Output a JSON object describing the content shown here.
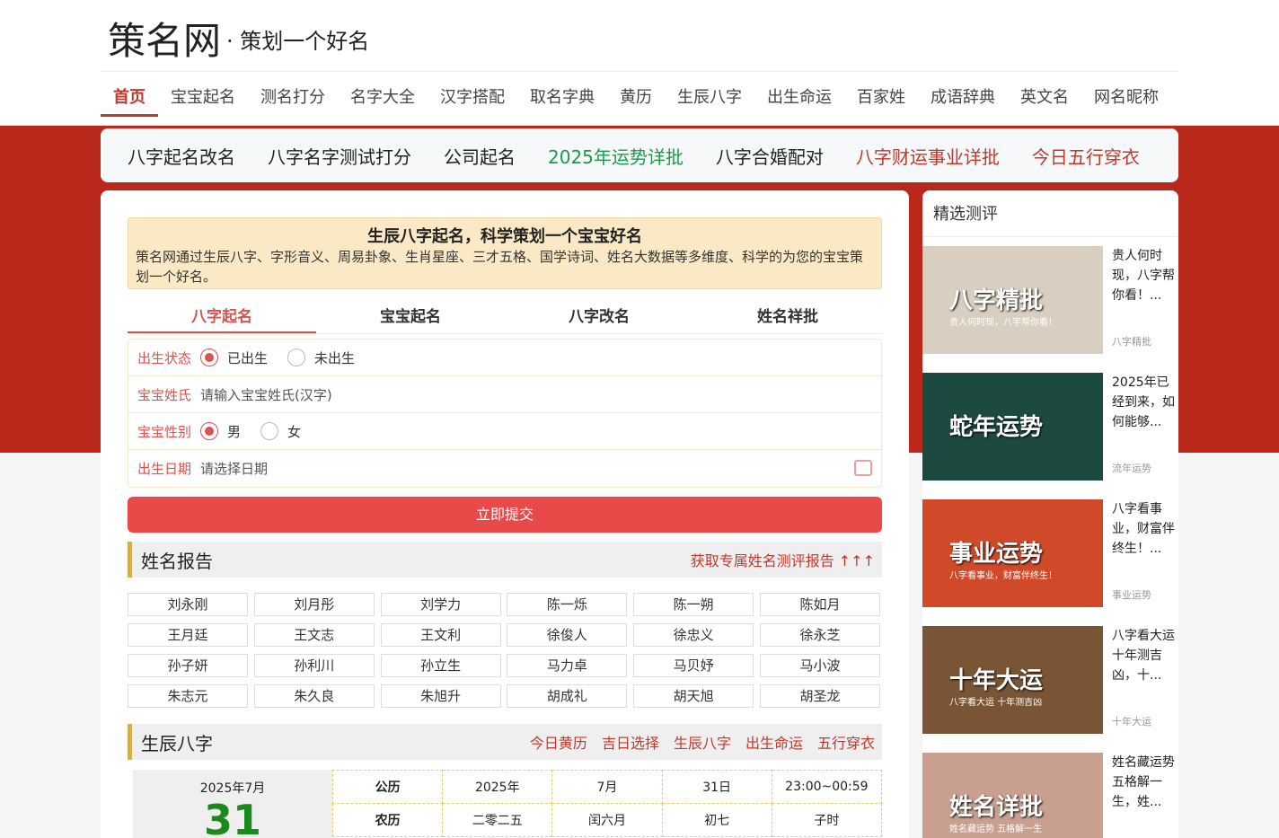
{
  "header": {
    "logo": "策名网",
    "slogan": "· 策划一个好名"
  },
  "nav": [
    "首页",
    "宝宝起名",
    "测名打分",
    "名字大全",
    "汉字搭配",
    "取名字典",
    "黄历",
    "生辰八字",
    "出生命运",
    "百家姓",
    "成语辞典",
    "英文名",
    "网名昵称"
  ],
  "subnav": [
    {
      "label": "八字起名改名",
      "style": "normal"
    },
    {
      "label": "八字名字测试打分",
      "style": "normal"
    },
    {
      "label": "公司起名",
      "style": "normal"
    },
    {
      "label": "2025年运势详批",
      "style": "green"
    },
    {
      "label": "八字合婚配对",
      "style": "normal"
    },
    {
      "label": "八字财运事业详批",
      "style": "red"
    },
    {
      "label": "今日五行穿衣",
      "style": "red"
    }
  ],
  "intro": {
    "title": "生辰八字起名，科学策划一个宝宝好名",
    "text": "策名网通过生辰八字、字形音义、周易卦象、生肖星座、三才五格、国学诗词、姓名大数据等多维度、科学的为您的宝宝策划一个好名。"
  },
  "tabs": [
    "八字起名",
    "宝宝起名",
    "八字改名",
    "姓名祥批"
  ],
  "form": {
    "birth_status_label": "出生状态",
    "born": "已出生",
    "unborn": "未出生",
    "surname_label": "宝宝姓氏",
    "surname_placeholder": "请输入宝宝姓氏(汉字)",
    "gender_label": "宝宝性别",
    "male": "男",
    "female": "女",
    "date_label": "出生日期",
    "date_placeholder": "请选择日期",
    "submit": "立即提交"
  },
  "report": {
    "title": "姓名报告",
    "link": "获取专属姓名测评报告 ↑↑↑",
    "names": [
      "刘永刚",
      "刘月彤",
      "刘学力",
      "陈一烁",
      "陈一朔",
      "陈如月",
      "王月廷",
      "王文志",
      "王文利",
      "徐俊人",
      "徐忠义",
      "徐永芝",
      "孙子妍",
      "孙利川",
      "孙立生",
      "马力卓",
      "马贝妤",
      "马小波",
      "朱志元",
      "朱久良",
      "朱旭升",
      "胡成礼",
      "胡天旭",
      "胡圣龙"
    ]
  },
  "bazi": {
    "title": "生辰八字",
    "links": [
      "今日黄历",
      "吉日选择",
      "生辰八字",
      "出生命运",
      "五行穿衣"
    ],
    "year_month": "2025年7月",
    "day": "31",
    "gregorian": [
      "公历",
      "2025年",
      "7月",
      "31日",
      "23:00~00:59"
    ],
    "lunar": [
      "农历",
      "二零二五",
      "闰六月",
      "初七",
      "子时"
    ]
  },
  "sidebar": {
    "title": "精选测评",
    "cards": [
      {
        "img_title": "八字精批",
        "img_sub": "贵人何时现，八字帮你看！",
        "text": "贵人何时现，八字帮你看！...",
        "tag": "八字精批",
        "bg": "#d8cfc0"
      },
      {
        "img_title": "蛇年运势",
        "img_sub": "",
        "text": "2025年已经到来，如何能够...",
        "tag": "流年运势",
        "bg": "#1d4a40"
      },
      {
        "img_title": "事业运势",
        "img_sub": "八字看事业，财富伴终生！",
        "text": "八字看事业，财富伴终生！...",
        "tag": "事业运势",
        "bg": "#d04a2a"
      },
      {
        "img_title": "十年大运",
        "img_sub": "八字看大运 十年测吉凶",
        "text": "八字看大运 十年测吉凶，十...",
        "tag": "十年大运",
        "bg": "#7a5535"
      },
      {
        "img_title": "姓名详批",
        "img_sub": "姓名藏运势 五格解一生",
        "text": "姓名藏运势 五格解一生，姓...",
        "tag": "",
        "bg": "#c9a090"
      }
    ]
  }
}
